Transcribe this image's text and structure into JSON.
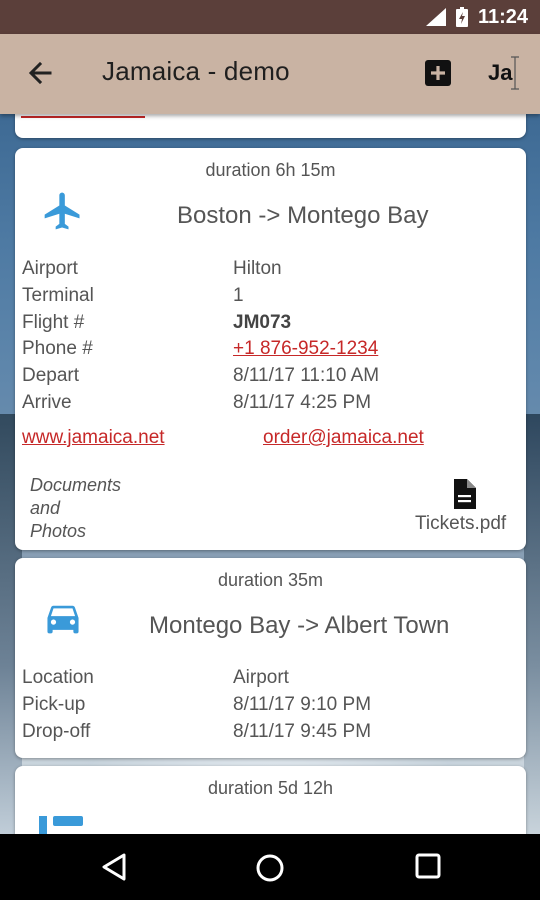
{
  "status_bar": {
    "time": "11:24"
  },
  "app_bar": {
    "title": "Jamaica - demo",
    "language_button": "Ja"
  },
  "cards": [
    {
      "duration": "duration 6h 15m",
      "icon": "flight-icon",
      "route": "Boston -> Montego Bay",
      "rows": [
        {
          "label": "Airport",
          "value": "Hilton"
        },
        {
          "label": "Terminal",
          "value": "1"
        },
        {
          "label": "Flight #",
          "value": "JM073"
        },
        {
          "label": "Phone #",
          "value": "+1 876-952-1234"
        },
        {
          "label": "Depart",
          "value": "8/11/17  11:10 AM"
        },
        {
          "label": "Arrive",
          "value": "8/11/17  4:25 PM"
        }
      ],
      "website": "www.jamaica.net",
      "email": "order@jamaica.net",
      "documents_label": [
        "Documents",
        "and",
        "Photos"
      ],
      "document_file": "Tickets.pdf"
    },
    {
      "duration": "duration 35m",
      "icon": "car-icon",
      "route": "Montego Bay -> Albert Town",
      "rows": [
        {
          "label": "Location",
          "value": "Airport"
        },
        {
          "label": "Pick-up",
          "value": "8/11/17  9:10 PM"
        },
        {
          "label": "Drop-off",
          "value": "8/11/17  9:45 PM"
        }
      ]
    },
    {
      "duration": "duration 5d 12h",
      "icon": "hotel-icon"
    }
  ],
  "colors": {
    "accent_blue": "#3a9ad9",
    "link_red": "#c62828",
    "app_bar": "#c9b3a3",
    "status_bar": "#5b3f3a"
  }
}
